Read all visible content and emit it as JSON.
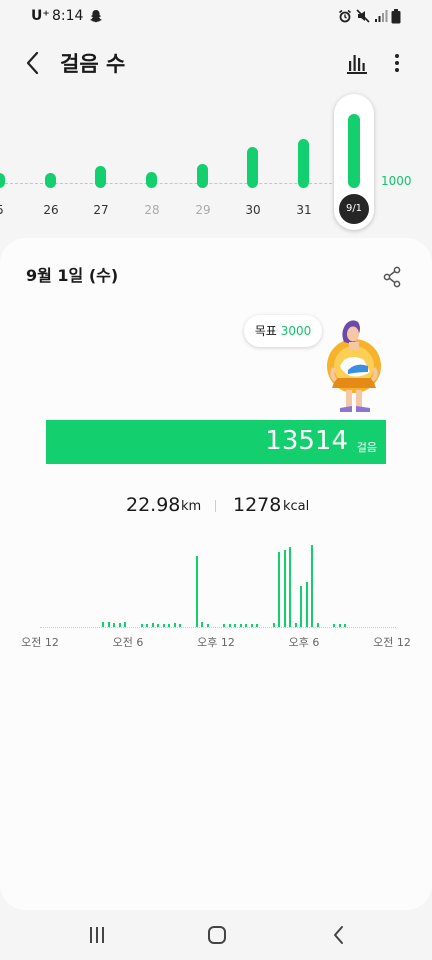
{
  "status_bar": {
    "carrier": "U⁺",
    "time": "8:14",
    "icons": [
      "snapchat-icon",
      "alarm-icon",
      "mute-icon",
      "signal-icon",
      "battery-icon"
    ]
  },
  "header": {
    "title": "걸음 수",
    "icons": [
      "back-arrow-icon",
      "bar-chart-icon",
      "more-vert-icon"
    ]
  },
  "daily_strip": {
    "goal_label": "1000",
    "days": [
      {
        "label": "5",
        "fill": 0.2,
        "muted": false
      },
      {
        "label": "26",
        "fill": 0.2,
        "muted": false
      },
      {
        "label": "27",
        "fill": 0.3,
        "muted": false
      },
      {
        "label": "28",
        "fill": 0.22,
        "muted": true
      },
      {
        "label": "29",
        "fill": 0.33,
        "muted": true
      },
      {
        "label": "30",
        "fill": 0.55,
        "muted": false
      },
      {
        "label": "31",
        "fill": 0.66,
        "muted": false
      }
    ],
    "selected": {
      "label": "9/1",
      "fill": 1.0
    }
  },
  "summary": {
    "date": "9월 1일 (수)",
    "goal_prefix": "목표",
    "goal_value": "3000",
    "steps": "13514",
    "steps_unit": "걸음",
    "distance": "22.98",
    "distance_unit": "km",
    "calories": "1278",
    "calories_unit": "kcal",
    "hour_labels": [
      "오전 12",
      "오전 6",
      "오후 12",
      "오후 6",
      "오전 12"
    ],
    "hourly_fill": [
      0.06,
      0.06,
      0.05,
      0.05,
      0.06,
      0.0,
      0.0,
      0.03,
      0.03,
      0.04,
      0.03,
      0.03,
      0.03,
      0.04,
      0.03,
      0.0,
      0.0,
      0.81,
      0.06,
      0.03,
      0.0,
      0.0,
      0.03,
      0.03,
      0.03,
      0.03,
      0.03,
      0.03,
      0.03,
      0.0,
      0.0,
      0.05,
      0.85,
      0.87,
      0.91,
      0.05,
      0.47,
      0.51,
      0.93,
      0.04,
      0.0,
      0.0,
      0.03,
      0.03,
      0.03
    ]
  },
  "colors": {
    "accent": "#13cf6d",
    "accent_text": "#13c36b"
  }
}
